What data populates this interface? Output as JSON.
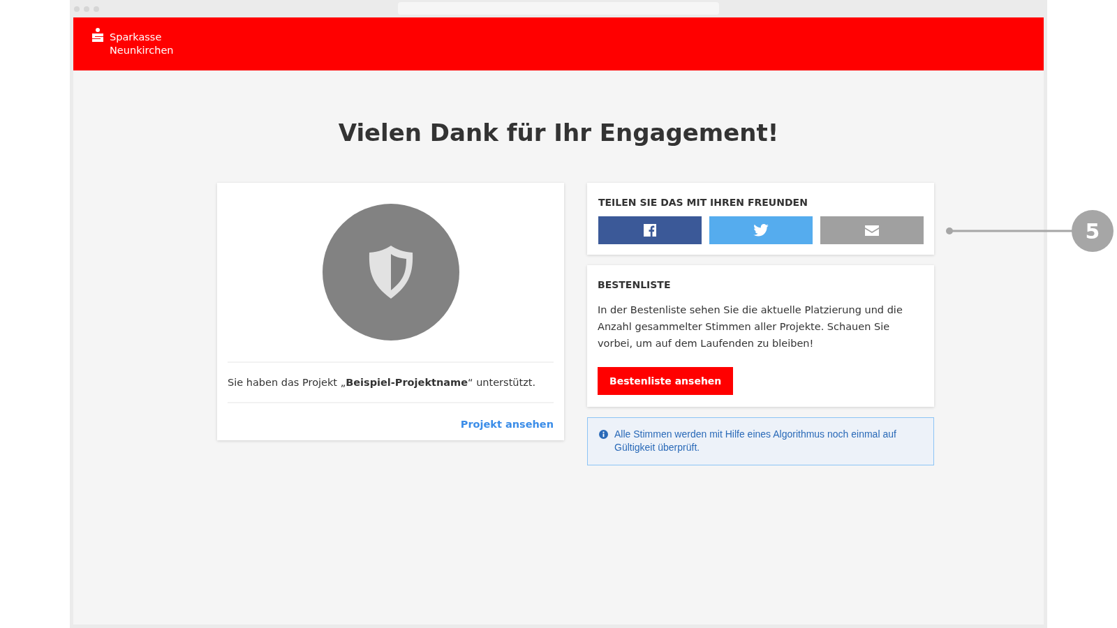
{
  "header": {
    "logo_text": [
      "Sparkasse",
      "Neunkirchen"
    ]
  },
  "title": "Vielen Dank für Ihr Engagement!",
  "project_card": {
    "message": "Sie haben das Projekt „**Beispiel-Projektname**“ unterstützt.",
    "link": "Projekt ansehen"
  },
  "share_card": {
    "heading": "TEILEN SIE DAS MIT IHREN FREUNDEN",
    "buttons": [
      {
        "kind": "facebook",
        "color": "#3b5998"
      },
      {
        "kind": "twitter",
        "color": "#55acee"
      },
      {
        "kind": "email",
        "color": "#a0a0a0"
      }
    ]
  },
  "leaderboard_card": {
    "heading": "BESTENLISTE",
    "text": "In der Bestenliste sehen Sie die aktuelle Platzierung und die Anzahl gesammelter Stimmen aller Projekte. Schauen Sie vorbei, um auf dem Laufenden zu bleiben!",
    "button": "Bestenliste ansehen"
  },
  "info_note": "Alle Stimmen werden mit Hilfe eines Algorithmus noch einmal auf Gültigkeit überprüft.",
  "callout": "5"
}
